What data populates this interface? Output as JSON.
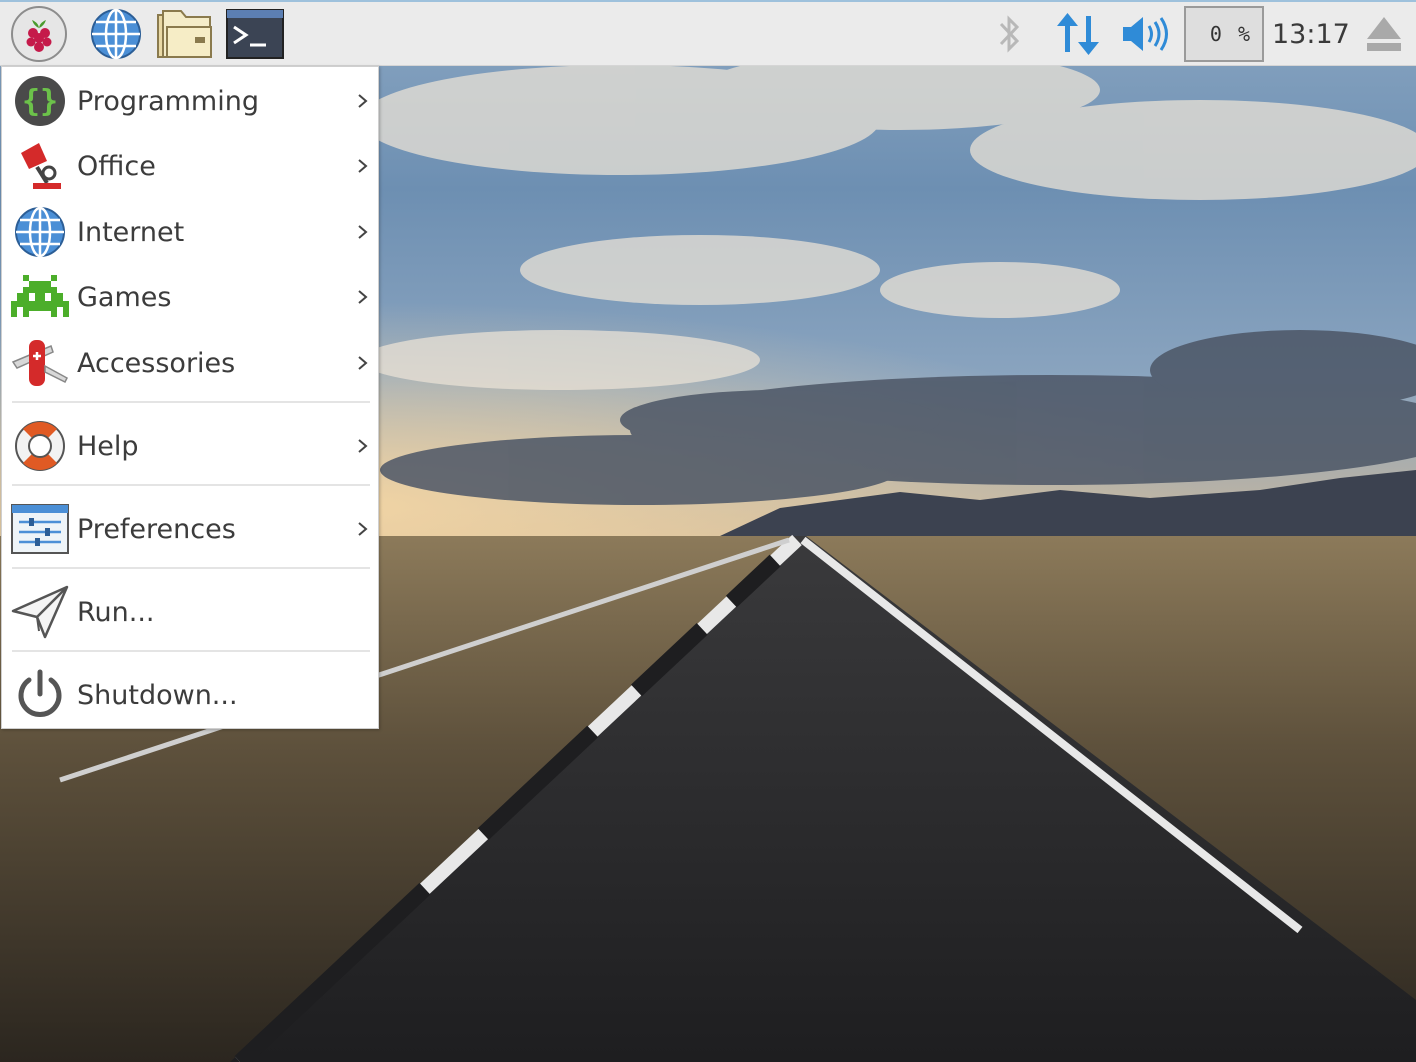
{
  "panel": {
    "launchers": [
      {
        "name": "menu-button",
        "icon": "raspberry-icon"
      },
      {
        "name": "web-browser-launcher",
        "icon": "globe-icon"
      },
      {
        "name": "file-manager-launcher",
        "icon": "folder-icon"
      },
      {
        "name": "terminal-launcher",
        "icon": "terminal-icon"
      }
    ],
    "tray": {
      "bluetooth_icon": "bluetooth-icon",
      "network_icon": "network-updown-icon",
      "volume_icon": "volume-icon",
      "cpu_usage": "0 %",
      "clock": "13:17",
      "eject_icon": "eject-icon"
    },
    "colors": {
      "accent": "#2f8bd7",
      "panel_bg": "#ebebeb"
    }
  },
  "menu": {
    "items": [
      {
        "label": "Programming",
        "icon": "code-braces-icon",
        "submenu": true
      },
      {
        "label": "Office",
        "icon": "desk-lamp-icon",
        "submenu": true
      },
      {
        "label": "Internet",
        "icon": "globe-icon",
        "submenu": true
      },
      {
        "label": "Games",
        "icon": "space-invader-icon",
        "submenu": true
      },
      {
        "label": "Accessories",
        "icon": "pocket-knife-icon",
        "submenu": true
      },
      {
        "label": "Help",
        "icon": "lifebuoy-icon",
        "submenu": true
      },
      {
        "label": "Preferences",
        "icon": "sliders-icon",
        "submenu": true
      },
      {
        "label": "Run...",
        "icon": "paper-plane-icon",
        "submenu": false
      },
      {
        "label": "Shutdown...",
        "icon": "power-icon",
        "submenu": false
      }
    ]
  },
  "desktop": {
    "wallpaper": "road-to-horizon-under-cloudy-sky"
  }
}
